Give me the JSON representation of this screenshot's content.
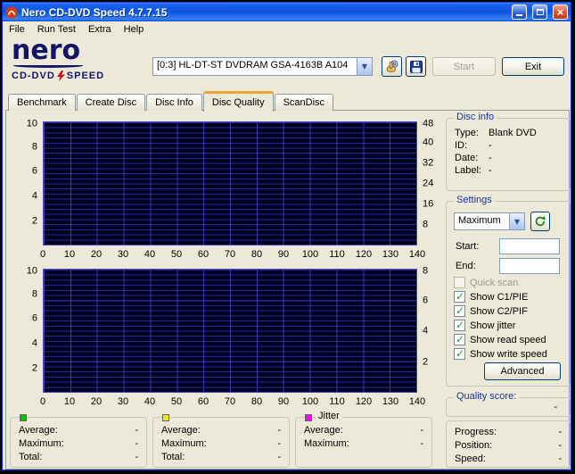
{
  "window": {
    "title": "Nero CD-DVD Speed 4.7.7.15"
  },
  "menu": {
    "items": [
      "File",
      "Run Test",
      "Extra",
      "Help"
    ]
  },
  "logo": {
    "brand": "nero",
    "subtitle": "CD-DVD",
    "subtitle2": "SPEED"
  },
  "toolbar": {
    "drive_selected": "[0:3]  HL-DT-ST DVDRAM GSA-4163B A104",
    "start_label": "Start",
    "exit_label": "Exit"
  },
  "tabs": {
    "items": [
      "Benchmark",
      "Create Disc",
      "Disc Info",
      "Disc Quality",
      "ScanDisc"
    ],
    "active": "Disc Quality"
  },
  "disc_info": {
    "title": "Disc info",
    "rows": [
      {
        "label": "Type:",
        "value": "Blank DVD"
      },
      {
        "label": "ID:",
        "value": "-"
      },
      {
        "label": "Date:",
        "value": "-"
      },
      {
        "label": "Label:",
        "value": "-"
      }
    ]
  },
  "settings": {
    "title": "Settings",
    "speed_selected": "Maximum",
    "start_label": "Start:",
    "start_value": "",
    "end_label": "End:",
    "end_value": "",
    "quick_scan_label": "Quick scan",
    "options": [
      {
        "label": "Show C1/PIE",
        "checked": true
      },
      {
        "label": "Show C2/PIF",
        "checked": true
      },
      {
        "label": "Show jitter",
        "checked": true
      },
      {
        "label": "Show read speed",
        "checked": true
      },
      {
        "label": "Show write speed",
        "checked": true
      }
    ],
    "advanced_label": "Advanced"
  },
  "quality": {
    "title": "Quality score:",
    "value": "-"
  },
  "legend_boxes": [
    {
      "color": "#00BE00",
      "title": "",
      "rows": [
        {
          "label": "Average:",
          "value": "-"
        },
        {
          "label": "Maximum:",
          "value": "-"
        },
        {
          "label": "Total:",
          "value": "-"
        }
      ]
    },
    {
      "color": "#E8E800",
      "title": "",
      "rows": [
        {
          "label": "Average:",
          "value": "-"
        },
        {
          "label": "Maximum:",
          "value": "-"
        },
        {
          "label": "Total:",
          "value": "-"
        }
      ]
    },
    {
      "color": "#FF00FF",
      "title": "Jitter",
      "rows": [
        {
          "label": "Average:",
          "value": "-"
        },
        {
          "label": "Maximum:",
          "value": "-"
        }
      ]
    }
  ],
  "status": {
    "rows": [
      {
        "label": "Progress:",
        "value": "-"
      },
      {
        "label": "Position:",
        "value": "-"
      },
      {
        "label": "Speed:",
        "value": "-"
      }
    ]
  },
  "icons": {
    "app": "nero-flame",
    "drive_arrow": "chevron-down",
    "eject": "hand-with-disc",
    "save": "floppy-disk",
    "refresh": "circular-arrows",
    "check": "green-check",
    "bolt": "lightning-bolt"
  },
  "colors": {
    "titlebar": "#0A55E5",
    "window_bg": "#ECE9D8",
    "plot_bg": "#000020",
    "grid_line": "#3C3CD2",
    "check": "#1BA11B",
    "series_green": "#00BE00",
    "series_yellow": "#E8E800",
    "series_magenta": "#FF00FF"
  },
  "chart_data": [
    {
      "type": "line",
      "title": "",
      "series": [],
      "x_ticks": [
        0,
        10,
        20,
        30,
        40,
        50,
        60,
        70,
        80,
        90,
        100,
        110,
        120,
        130,
        140
      ],
      "left_ticks": [
        10,
        8,
        6,
        4,
        2
      ],
      "right_ticks": [
        48,
        40,
        32,
        24,
        16,
        8
      ],
      "xlim": [
        0,
        140
      ],
      "left_ylim": [
        0,
        10
      ],
      "right_ylim": [
        0,
        48
      ],
      "grid": true
    },
    {
      "type": "line",
      "title": "",
      "series": [],
      "x_ticks": [
        0,
        10,
        20,
        30,
        40,
        50,
        60,
        70,
        80,
        90,
        100,
        110,
        120,
        130,
        140
      ],
      "left_ticks": [
        10,
        8,
        6,
        4,
        2
      ],
      "right_ticks": [
        8,
        6,
        4,
        2
      ],
      "xlim": [
        0,
        140
      ],
      "left_ylim": [
        0,
        10
      ],
      "right_ylim": [
        0,
        8
      ],
      "grid": true
    }
  ]
}
